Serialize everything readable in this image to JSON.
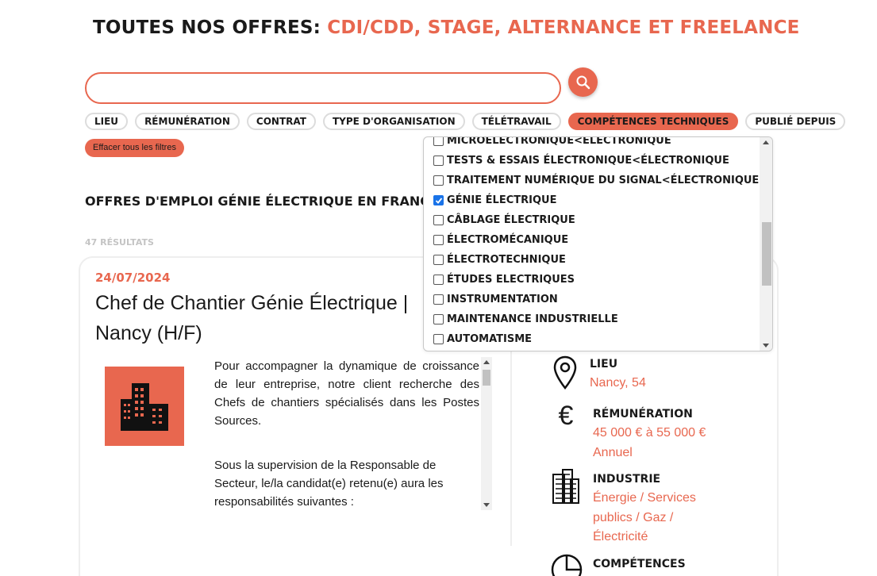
{
  "header": {
    "title_prefix": "TOUTES NOS OFFRES:",
    "title_accent": "CDI/CDD, STAGE, ALTERNANCE ET FREELANCE"
  },
  "search": {
    "value": "",
    "placeholder": ""
  },
  "filters": [
    {
      "label": "LIEU",
      "active": false
    },
    {
      "label": "RÉMUNÉRATION",
      "active": false
    },
    {
      "label": "CONTRAT",
      "active": false
    },
    {
      "label": "TYPE D'ORGANISATION",
      "active": false
    },
    {
      "label": "TÉLÉTRAVAIL",
      "active": false
    },
    {
      "label": "COMPÉTENCES TECHNIQUES",
      "active": true
    },
    {
      "label": "PUBLIÉ DEPUIS",
      "active": false
    }
  ],
  "clear_filters_label": "Effacer tous les filtres",
  "section_title": "OFFRES D'EMPLOI GÉNIE ÉLECTRIQUE EN FRANCE",
  "results_count": "47 RÉSULTATS",
  "dropdown": {
    "items": [
      {
        "label": "MICROÉLECTRONIQUE<ÉLECTRONIQUE",
        "checked": false
      },
      {
        "label": "TESTS & ESSAIS ÉLECTRONIQUE<ÉLECTRONIQUE",
        "checked": false
      },
      {
        "label": "TRAITEMENT NUMÉRIQUE DU SIGNAL<ÉLECTRONIQUE",
        "checked": false
      },
      {
        "label": "GÉNIE ÉLECTRIQUE",
        "checked": true
      },
      {
        "label": "CÂBLAGE ÉLECTRIQUE",
        "checked": false
      },
      {
        "label": "ÉLECTROMÉCANIQUE",
        "checked": false
      },
      {
        "label": "ÉLECTROTECHNIQUE",
        "checked": false
      },
      {
        "label": "ÉTUDES ELECTRIQUES",
        "checked": false
      },
      {
        "label": "INSTRUMENTATION",
        "checked": false
      },
      {
        "label": "MAINTENANCE INDUSTRIELLE",
        "checked": false
      },
      {
        "label": "AUTOMATISME",
        "checked": false
      }
    ]
  },
  "job": {
    "date": "24/07/2024",
    "title": "Chef de Chantier Génie Électrique | Nancy (H/F)",
    "description_1": "Pour accompagner la dynamique de croissance de leur entreprise, notre client recherche des Chefs de chantiers spécialisés dans les Postes Sources.",
    "description_2": "Sous la supervision de la Responsable de Secteur, le/la candidat(e) retenu(e) aura les responsabilités suivantes :",
    "location_label": "LIEU",
    "location_value": "Nancy, 54",
    "salary_label": "RÉMUNÉRATION",
    "salary_value": "45 000 € à 55 000 € Annuel",
    "industry_label": "INDUSTRIE",
    "industry_value": "Énergie / Services publics / Gaz / Électricité",
    "skills_label": "COMPÉTENCES"
  },
  "colors": {
    "accent": "#e8674f",
    "text": "#1a1a1a",
    "muted": "#c4c4c4",
    "border": "#dcdcdc"
  },
  "icons": [
    "search-icon",
    "building-icon",
    "map-pin-icon",
    "euro-icon",
    "industry-building-icon",
    "pie-chart-icon",
    "checkbox-checked-icon"
  ]
}
